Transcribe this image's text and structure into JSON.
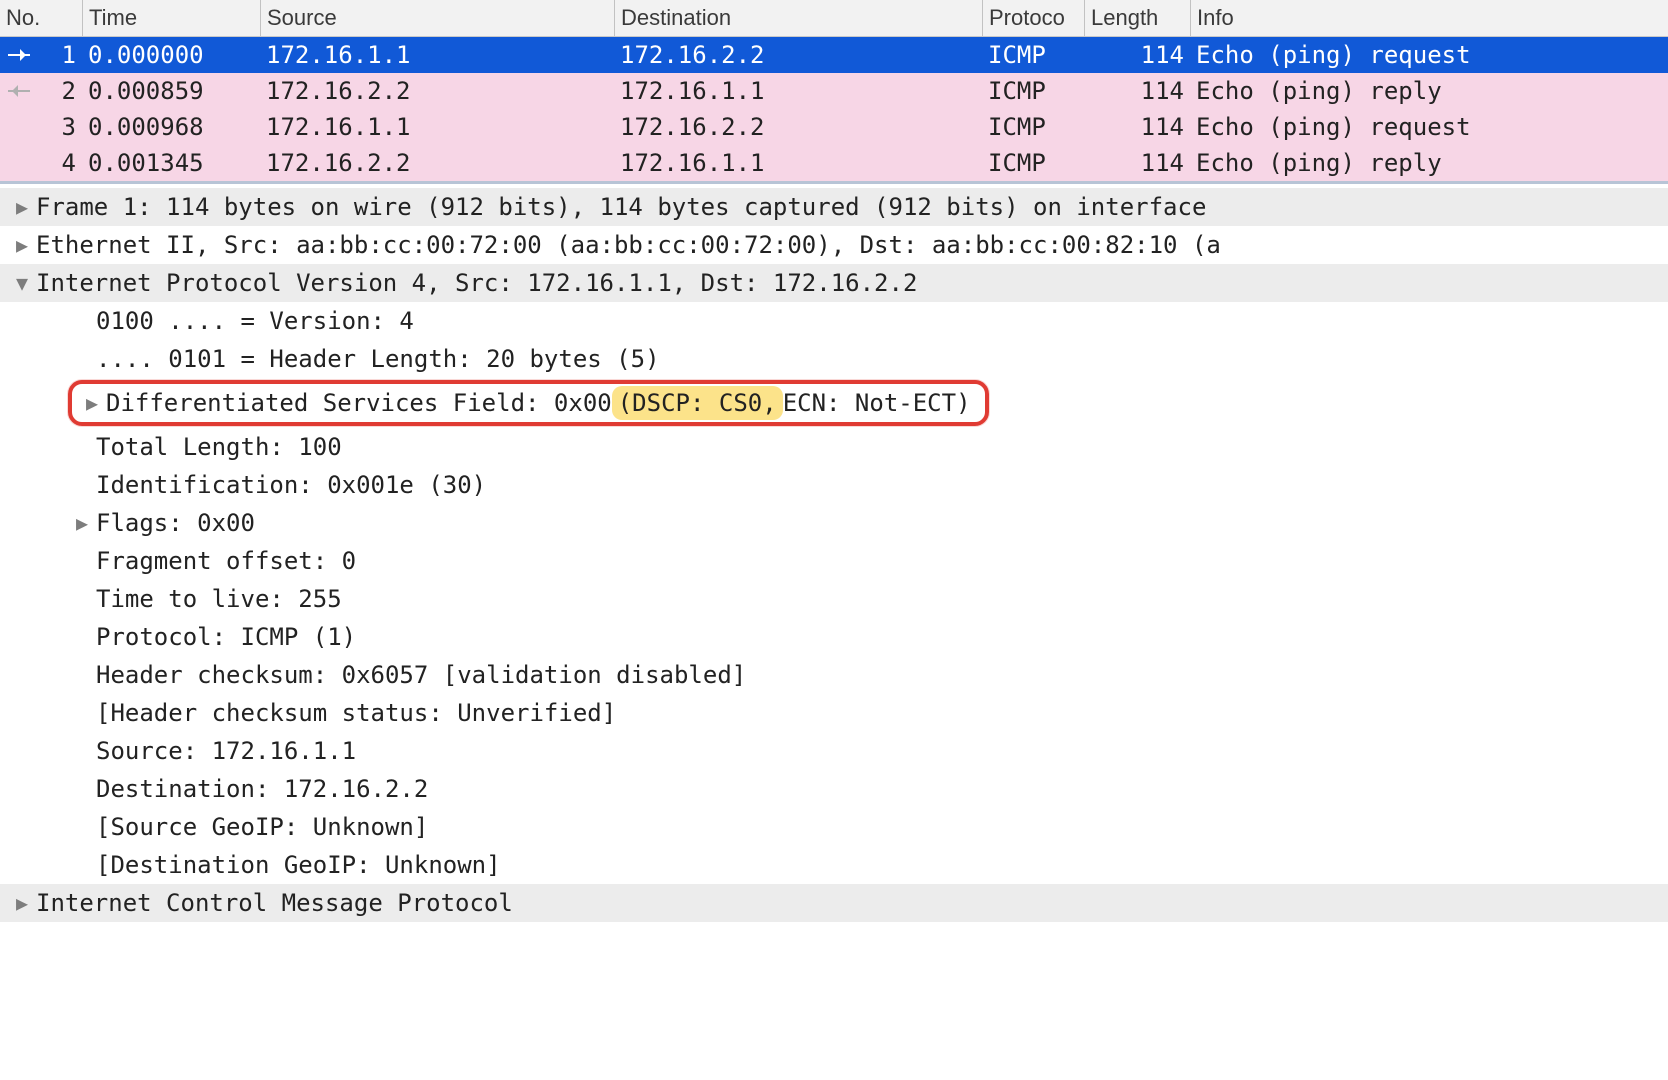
{
  "columns": {
    "no": "No.",
    "time": "Time",
    "src": "Source",
    "dst": "Destination",
    "proto": "Protoco",
    "len": "Length",
    "info": "Info"
  },
  "packets": [
    {
      "arrow": "right",
      "no": "1",
      "time": "0.000000",
      "src": "172.16.1.1",
      "dst": "172.16.2.2",
      "proto": "ICMP",
      "len": "114",
      "info": "Echo (ping) request",
      "style": "selected"
    },
    {
      "arrow": "left",
      "no": "2",
      "time": "0.000859",
      "src": "172.16.2.2",
      "dst": "172.16.1.1",
      "proto": "ICMP",
      "len": "114",
      "info": "Echo (ping) reply",
      "style": "pink"
    },
    {
      "arrow": "",
      "no": "3",
      "time": "0.000968",
      "src": "172.16.1.1",
      "dst": "172.16.2.2",
      "proto": "ICMP",
      "len": "114",
      "info": "Echo (ping) request",
      "style": "pink"
    },
    {
      "arrow": "",
      "no": "4",
      "time": "0.001345",
      "src": "172.16.2.2",
      "dst": "172.16.1.1",
      "proto": "ICMP",
      "len": "114",
      "info": "Echo (ping) reply",
      "style": "pink"
    }
  ],
  "tree": {
    "frame": "Frame 1: 114 bytes on wire (912 bits), 114 bytes captured (912 bits) on interface",
    "eth": "Ethernet II, Src: aa:bb:cc:00:72:00 (aa:bb:cc:00:72:00), Dst: aa:bb:cc:00:82:10 (a",
    "ip": "Internet Protocol Version 4, Src: 172.16.1.1, Dst: 172.16.2.2",
    "ip_fields": {
      "version": "0100 .... = Version: 4",
      "hdrlen": ".... 0101 = Header Length: 20 bytes (5)",
      "dsf_prefix": "Differentiated Services Field: 0x00 ",
      "dsf_hl": "(DSCP: CS0,",
      "dsf_suffix": " ECN: Not-ECT)",
      "totlen": "Total Length: 100",
      "ident": "Identification: 0x001e (30)",
      "flags": "Flags: 0x00",
      "fragoff": "Fragment offset: 0",
      "ttl": "Time to live: 255",
      "proto": "Protocol: ICMP (1)",
      "cksum": "Header checksum: 0x6057 [validation disabled]",
      "cksum_stat": "[Header checksum status: Unverified]",
      "src": "Source: 172.16.1.1",
      "dst": "Destination: 172.16.2.2",
      "geo_src": "[Source GeoIP: Unknown]",
      "geo_dst": "[Destination GeoIP: Unknown]"
    },
    "icmp": "Internet Control Message Protocol"
  }
}
